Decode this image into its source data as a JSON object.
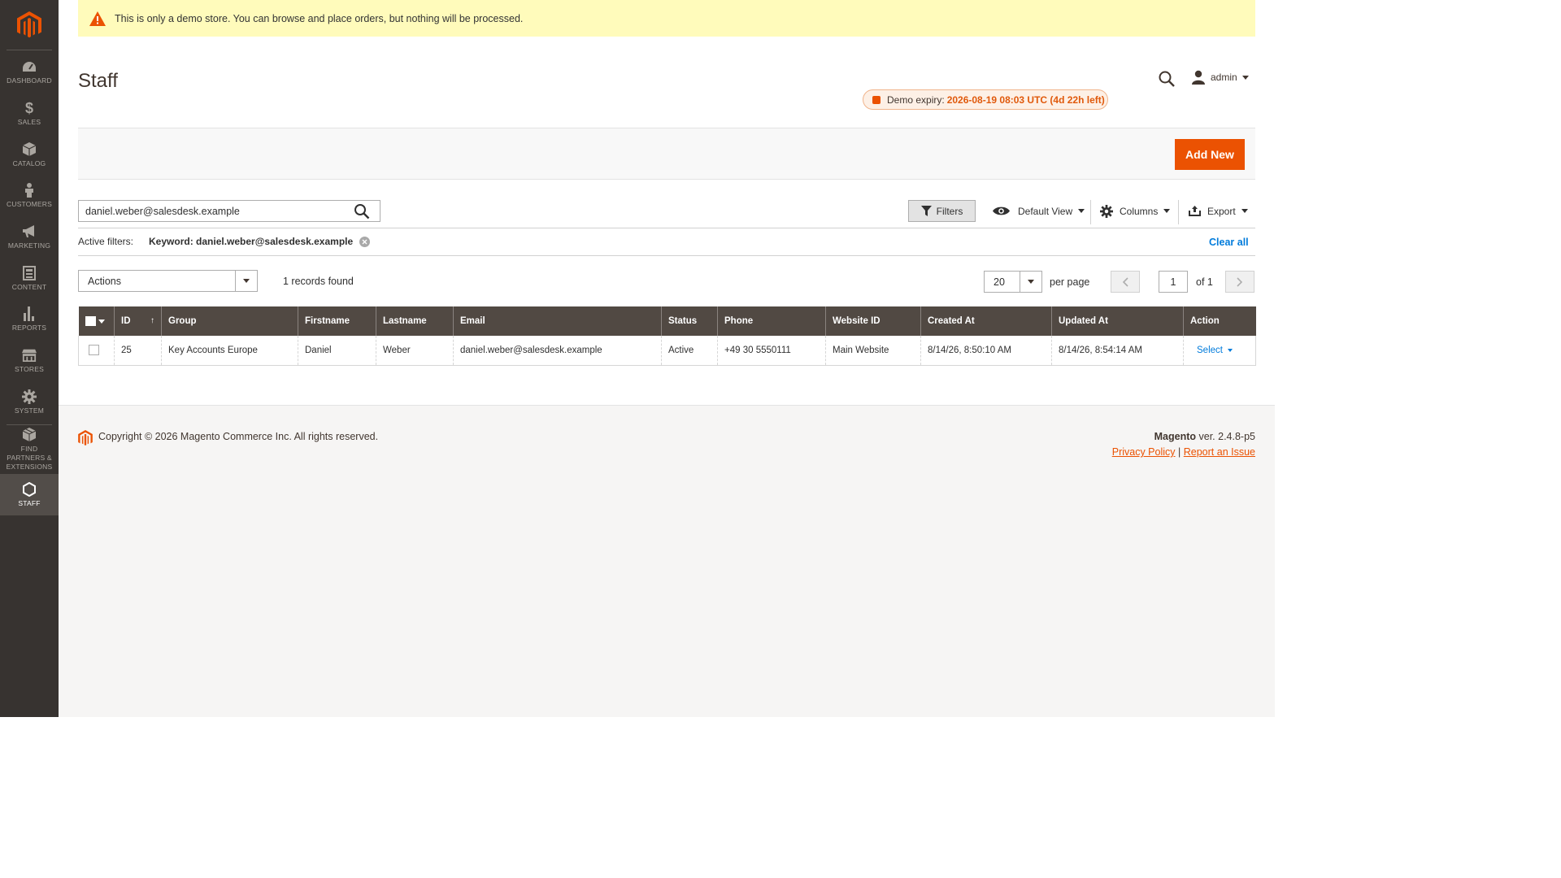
{
  "notice": {
    "text": "This is only a demo store. You can browse and place orders, but nothing will be processed."
  },
  "sidebar": {
    "items": [
      {
        "label": "DASHBOARD",
        "icon": "dashboard-icon"
      },
      {
        "label": "SALES",
        "icon": "dollar-icon"
      },
      {
        "label": "CATALOG",
        "icon": "box-icon"
      },
      {
        "label": "CUSTOMERS",
        "icon": "person-icon"
      },
      {
        "label": "MARKETING",
        "icon": "megaphone-icon"
      },
      {
        "label": "CONTENT",
        "icon": "layout-icon"
      },
      {
        "label": "REPORTS",
        "icon": "bar-chart-icon"
      },
      {
        "label": "STORES",
        "icon": "store-icon"
      },
      {
        "label": "SYSTEM",
        "icon": "gear-icon"
      },
      {
        "label": "FIND PARTNERS & EXTENSIONS",
        "icon": "cubes-icon"
      },
      {
        "label": "STAFF",
        "icon": "hexagon-icon"
      }
    ]
  },
  "header": {
    "title": "Staff",
    "user": "admin",
    "demo_label": "Demo expiry:",
    "demo_value": "2026-08-19 08:03 UTC (4d 22h left)"
  },
  "action_bar": {
    "add_new": "Add New"
  },
  "toolbar": {
    "search_value": "daniel.weber@salesdesk.example",
    "filters": "Filters",
    "view": "Default View",
    "columns": "Columns",
    "export": "Export"
  },
  "active_filters": {
    "label": "Active filters:",
    "chip": "Keyword: daniel.weber@salesdesk.example",
    "clear_all": "Clear all"
  },
  "pager": {
    "actions": "Actions",
    "records": "1 records found",
    "per_page_value": "20",
    "per_page_label": "per page",
    "page_value": "1",
    "of_pages": "of 1"
  },
  "table": {
    "headers": {
      "id": "ID",
      "sort": "↑",
      "group": "Group",
      "firstname": "Firstname",
      "lastname": "Lastname",
      "email": "Email",
      "status": "Status",
      "phone": "Phone",
      "website": "Website ID",
      "created": "Created At",
      "updated": "Updated At",
      "action": "Action"
    },
    "rows": [
      {
        "id": "25",
        "group": "Key Accounts Europe",
        "firstname": "Daniel",
        "lastname": "Weber",
        "email": "daniel.weber@salesdesk.example",
        "status": "Active",
        "phone": "+49 30 5550111",
        "website": "Main Website",
        "created": "8/14/26, 8:50:10 AM",
        "updated": "8/14/26, 8:54:14 AM",
        "action": "Select"
      }
    ]
  },
  "footer": {
    "copyright": "Copyright © 2026 Magento Commerce Inc. All rights reserved.",
    "brand": "Magento",
    "version": " ver. 2.4.8-p5",
    "privacy": "Privacy Policy",
    "separator": "|",
    "report": "Report an Issue"
  },
  "colors": {
    "accent": "#eb5202",
    "sidebar": "#373330",
    "table_header": "#514943",
    "link": "#007bdb",
    "notice_bg": "#fffbbb"
  }
}
